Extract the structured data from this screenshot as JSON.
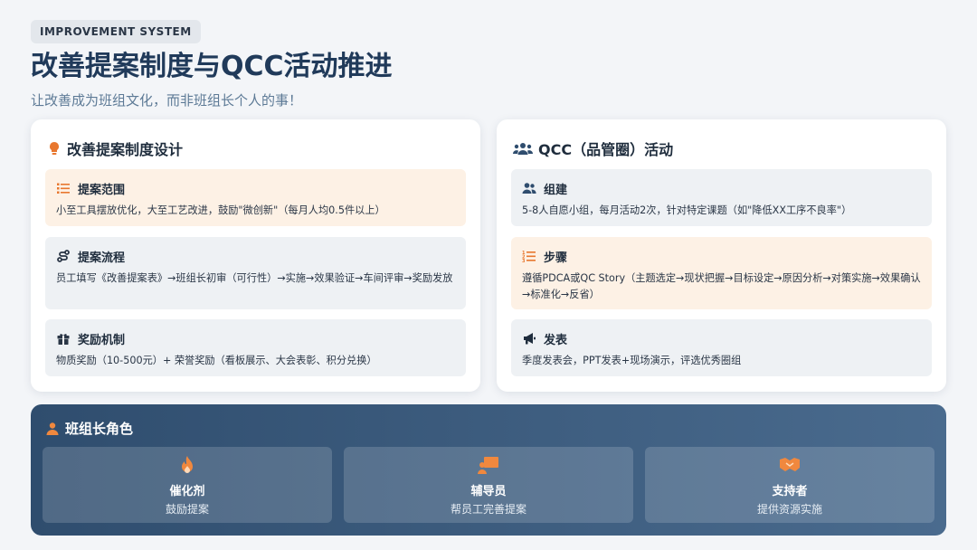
{
  "header": {
    "tag": "IMPROVEMENT SYSTEM",
    "title": "改善提案制度与QCC活动推进",
    "subtitle": "让改善成为班组文化，而非班组长个人的事！"
  },
  "left_card": {
    "title": "改善提案制度设计",
    "items": [
      {
        "title": "提案范围",
        "text": "小至工具摆放优化，大至工艺改进，鼓励\"微创新\"（每月人均0.5件以上）",
        "icon": "list-icon",
        "style": "orange"
      },
      {
        "title": "提案流程",
        "text": "员工填写《改善提案表》→班组长初审（可行性）→实施→效果验证→车间评审→奖励发放",
        "icon": "route-icon",
        "style": "gray"
      },
      {
        "title": "奖励机制",
        "text": "物质奖励（10-500元）+ 荣誉奖励（看板展示、大会表彰、积分兑换）",
        "icon": "gift-icon",
        "style": "gray"
      }
    ]
  },
  "right_card": {
    "title": "QCC（品管圈）活动",
    "items": [
      {
        "title": "组建",
        "text": "5-8人自愿小组，每月活动2次，针对特定课题（如\"降低XX工序不良率\"）",
        "icon": "users-icon",
        "style": "gray"
      },
      {
        "title": "步骤",
        "text": "遵循PDCA或QC Story（主题选定→现状把握→目标设定→原因分析→对策实施→效果确认→标准化→反省）",
        "icon": "steps-list-icon",
        "style": "orange"
      },
      {
        "title": "发表",
        "text": "季度发表会，PPT发表+现场演示，评选优秀圈组",
        "icon": "megaphone-icon",
        "style": "gray"
      }
    ]
  },
  "bottom": {
    "title": "班组长角色",
    "roles": [
      {
        "name": "催化剂",
        "desc": "鼓励提案",
        "icon": "fire-icon"
      },
      {
        "name": "辅导员",
        "desc": "帮员工完善提案",
        "icon": "teacher-icon"
      },
      {
        "name": "支持者",
        "desc": "提供资源实施",
        "icon": "handshake-icon"
      }
    ]
  },
  "colors": {
    "accent_orange": "#e8772e",
    "title_blue": "#203a5a",
    "subtitle_blue": "#5d7a96",
    "orange_bg": "#fdf1e5",
    "gray_bg": "#eef1f4",
    "panel_dark": "#2f4d6e"
  }
}
